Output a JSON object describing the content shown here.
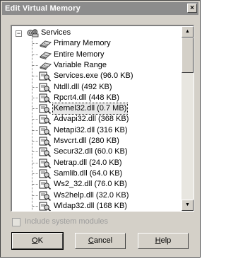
{
  "window": {
    "title": "Edit Virtual Memory",
    "close_glyph": "×"
  },
  "tree": {
    "root": {
      "label": "Services",
      "expander": "−",
      "icon": "services-gear-icon"
    },
    "items": [
      {
        "label": "Primary Memory",
        "icon": "memory-icon"
      },
      {
        "label": "Entire Memory",
        "icon": "memory-icon"
      },
      {
        "label": "Variable Range",
        "icon": "memory-icon"
      },
      {
        "label": "Services.exe (96.0 KB)",
        "icon": "module-icon"
      },
      {
        "label": "Ntdll.dll (492 KB)",
        "icon": "module-icon"
      },
      {
        "label": "Rpcrt4.dll (448 KB)",
        "icon": "module-icon"
      },
      {
        "label": "Kernel32.dll (0.7 MB)",
        "icon": "module-icon",
        "selected": true
      },
      {
        "label": "Advapi32.dll (368 KB)",
        "icon": "module-icon"
      },
      {
        "label": "Netapi32.dll (316 KB)",
        "icon": "module-icon"
      },
      {
        "label": "Msvcrt.dll (280 KB)",
        "icon": "module-icon"
      },
      {
        "label": "Secur32.dll (60.0 KB)",
        "icon": "module-icon"
      },
      {
        "label": "Netrap.dll (24.0 KB)",
        "icon": "module-icon"
      },
      {
        "label": "Samlib.dll (64.0 KB)",
        "icon": "module-icon"
      },
      {
        "label": "Ws2_32.dll (76.0 KB)",
        "icon": "module-icon"
      },
      {
        "label": "Ws2help.dll (32.0 KB)",
        "icon": "module-icon"
      },
      {
        "label": "Wldap32.dll (168 KB)",
        "icon": "module-icon"
      }
    ]
  },
  "scrollbar": {
    "up_glyph": "▲",
    "down_glyph": "▼"
  },
  "checkbox": {
    "label": "Include system modules",
    "checked": false,
    "enabled": false
  },
  "buttons": {
    "ok": {
      "pre": "",
      "accel": "O",
      "post": "K"
    },
    "cancel": {
      "pre": "",
      "accel": "C",
      "post": "ancel"
    },
    "help": {
      "pre": "",
      "accel": "H",
      "post": "elp"
    }
  }
}
